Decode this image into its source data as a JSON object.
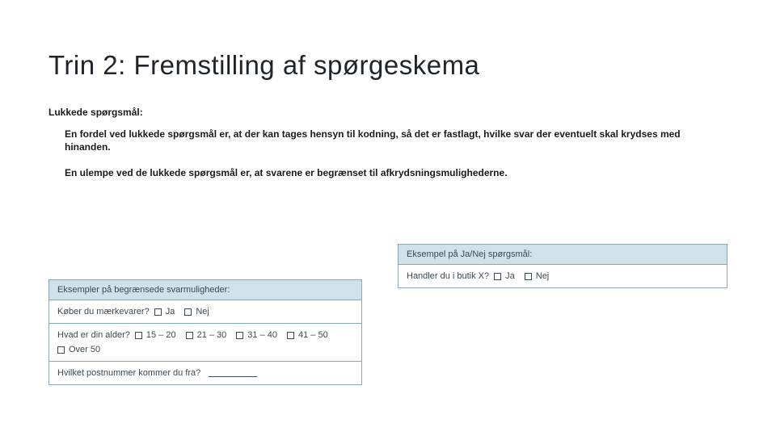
{
  "title": "Trin  2:  Fremstilling af spørgeskema",
  "section_label": "Lukkede spørgsmål:",
  "paragraph1": "En fordel ved lukkede spørgsmål er, at der kan tages hensyn til kodning, så det er fastlagt, hvilke svar der eventuelt skal krydses med hinanden.",
  "paragraph2": "En ulempe ved de lukkede spørgsmål er, at svarene er begrænset til afkrydsningsmulighederne.",
  "boxRight": {
    "header": "Eksempel på Ja/Nej spørgsmål:",
    "row1_q": "Handler du i butik X?",
    "opt_ja": "Ja",
    "opt_nej": "Nej"
  },
  "boxLeft": {
    "header": "Eksempler på begrænsede svarmuligheder:",
    "row1_q": "Køber du mærkevarer?",
    "row1_ja": "Ja",
    "row1_nej": "Nej",
    "row2_q": "Hvad er din alder?",
    "row2_o1": "15 – 20",
    "row2_o2": "21 – 30",
    "row2_o3": "31 – 40",
    "row2_o4": "41 – 50",
    "row2_o5": "Over 50",
    "row3_q": "Hvilket postnummer kommer du fra?"
  }
}
